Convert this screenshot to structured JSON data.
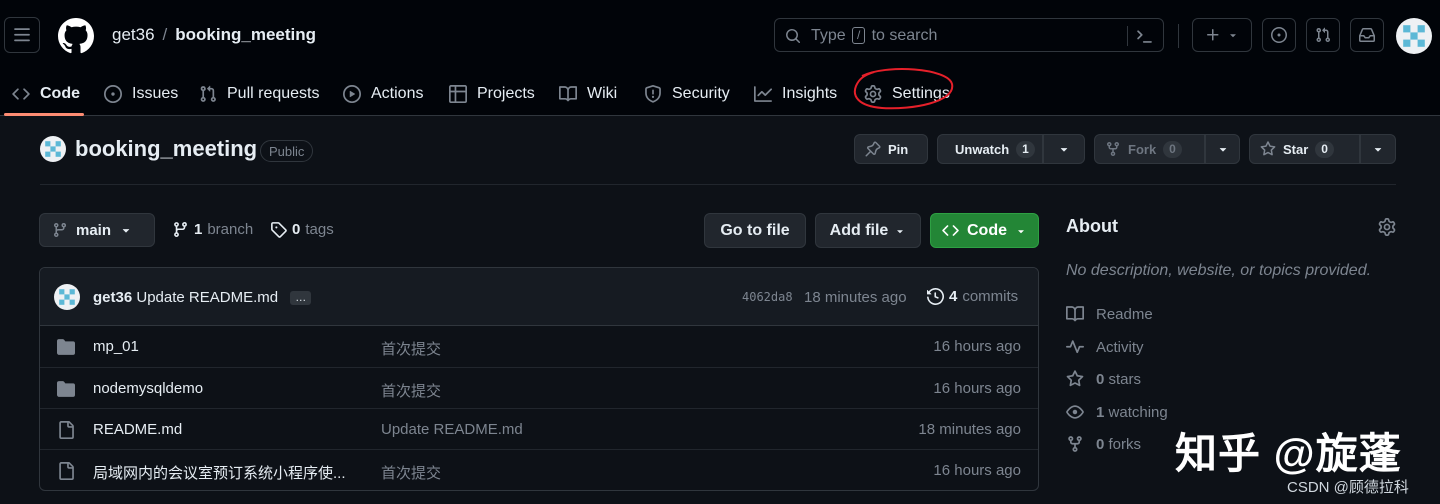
{
  "header": {
    "owner": "get36",
    "separator": "/",
    "repo": "booking_meeting",
    "search": {
      "before": "Type",
      "key": "/",
      "after": "to search"
    }
  },
  "nav": {
    "tabs": [
      {
        "label": "Code",
        "icon": "code-icon",
        "active": true
      },
      {
        "label": "Issues",
        "icon": "issue-opened-icon"
      },
      {
        "label": "Pull requests",
        "icon": "git-pull-request-icon"
      },
      {
        "label": "Actions",
        "icon": "play-icon"
      },
      {
        "label": "Projects",
        "icon": "table-icon"
      },
      {
        "label": "Wiki",
        "icon": "book-icon"
      },
      {
        "label": "Security",
        "icon": "shield-icon"
      },
      {
        "label": "Insights",
        "icon": "graph-icon"
      },
      {
        "label": "Settings",
        "icon": "gear-icon",
        "annotated": true
      }
    ],
    "active_underline_color": "#fd8c73",
    "annotation_color": "#e5202a"
  },
  "repo_header": {
    "name": "booking_meeting",
    "visibility": "Public",
    "pin_label": "Pin",
    "watch_label": "Unwatch",
    "watch_count": "1",
    "fork_label": "Fork",
    "fork_count": "0",
    "star_label": "Star",
    "star_count": "0"
  },
  "file_nav": {
    "branch": "main",
    "branch_count": "1",
    "branch_word": "branch",
    "tag_count": "0",
    "tag_word": "tags",
    "go_to_file": "Go to file",
    "add_file": "Add file",
    "code": "Code"
  },
  "latest_commit": {
    "author": "get36",
    "message": "Update README.md",
    "ellipsis": "…",
    "sha": "4062da8",
    "time": "18 minutes ago",
    "commit_count": "4",
    "commit_word": "commits"
  },
  "files": [
    {
      "type": "dir",
      "name": "mp_01",
      "message": "首次提交",
      "time": "16 hours ago"
    },
    {
      "type": "dir",
      "name": "nodemysqldemo",
      "message": "首次提交",
      "time": "16 hours ago"
    },
    {
      "type": "file",
      "name": "README.md",
      "message": "Update README.md",
      "time": "18 minutes ago"
    },
    {
      "type": "file",
      "name": "局域网内的会议室预订系统小程序使...",
      "message": "首次提交",
      "time": "16 hours ago"
    }
  ],
  "about": {
    "title": "About",
    "description": "No description, website, or topics provided.",
    "readme": "Readme",
    "activity": "Activity",
    "stars_count": "0",
    "stars_word": "stars",
    "watching_count": "1",
    "watching_word": "watching",
    "forks_count": "0",
    "forks_word": "forks"
  },
  "watermarks": {
    "zhihu": "知乎 @旋蓬",
    "csdn": "CSDN @顾德拉科"
  },
  "colors": {
    "page_bg": "#0d1117",
    "header_bg": "#010409",
    "code_button": "#238636",
    "muted_text": "#7d8590"
  }
}
